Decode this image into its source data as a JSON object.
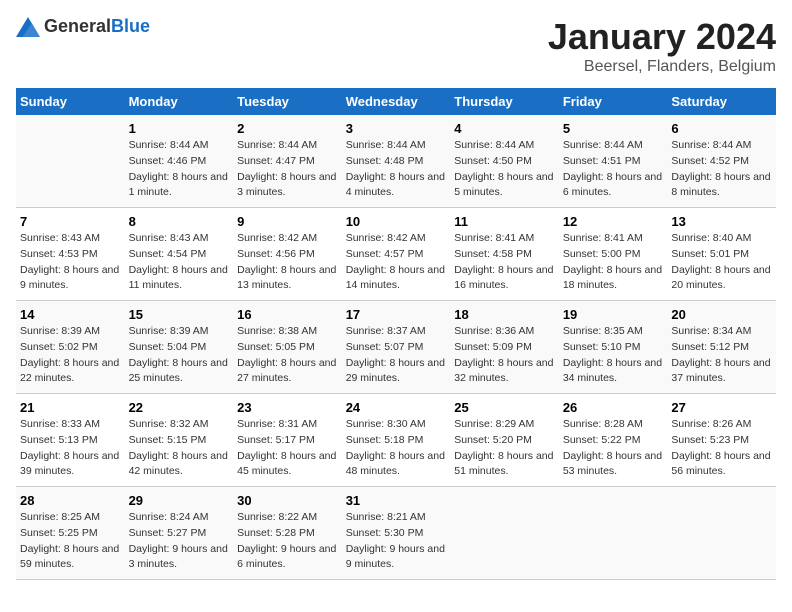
{
  "header": {
    "logo_general": "General",
    "logo_blue": "Blue",
    "title": "January 2024",
    "subtitle": "Beersel, Flanders, Belgium"
  },
  "weekdays": [
    "Sunday",
    "Monday",
    "Tuesday",
    "Wednesday",
    "Thursday",
    "Friday",
    "Saturday"
  ],
  "weeks": [
    [
      {
        "day": "",
        "sunrise": "",
        "sunset": "",
        "daylight": ""
      },
      {
        "day": "1",
        "sunrise": "Sunrise: 8:44 AM",
        "sunset": "Sunset: 4:46 PM",
        "daylight": "Daylight: 8 hours and 1 minute."
      },
      {
        "day": "2",
        "sunrise": "Sunrise: 8:44 AM",
        "sunset": "Sunset: 4:47 PM",
        "daylight": "Daylight: 8 hours and 3 minutes."
      },
      {
        "day": "3",
        "sunrise": "Sunrise: 8:44 AM",
        "sunset": "Sunset: 4:48 PM",
        "daylight": "Daylight: 8 hours and 4 minutes."
      },
      {
        "day": "4",
        "sunrise": "Sunrise: 8:44 AM",
        "sunset": "Sunset: 4:50 PM",
        "daylight": "Daylight: 8 hours and 5 minutes."
      },
      {
        "day": "5",
        "sunrise": "Sunrise: 8:44 AM",
        "sunset": "Sunset: 4:51 PM",
        "daylight": "Daylight: 8 hours and 6 minutes."
      },
      {
        "day": "6",
        "sunrise": "Sunrise: 8:44 AM",
        "sunset": "Sunset: 4:52 PM",
        "daylight": "Daylight: 8 hours and 8 minutes."
      }
    ],
    [
      {
        "day": "7",
        "sunrise": "Sunrise: 8:43 AM",
        "sunset": "Sunset: 4:53 PM",
        "daylight": "Daylight: 8 hours and 9 minutes."
      },
      {
        "day": "8",
        "sunrise": "Sunrise: 8:43 AM",
        "sunset": "Sunset: 4:54 PM",
        "daylight": "Daylight: 8 hours and 11 minutes."
      },
      {
        "day": "9",
        "sunrise": "Sunrise: 8:42 AM",
        "sunset": "Sunset: 4:56 PM",
        "daylight": "Daylight: 8 hours and 13 minutes."
      },
      {
        "day": "10",
        "sunrise": "Sunrise: 8:42 AM",
        "sunset": "Sunset: 4:57 PM",
        "daylight": "Daylight: 8 hours and 14 minutes."
      },
      {
        "day": "11",
        "sunrise": "Sunrise: 8:41 AM",
        "sunset": "Sunset: 4:58 PM",
        "daylight": "Daylight: 8 hours and 16 minutes."
      },
      {
        "day": "12",
        "sunrise": "Sunrise: 8:41 AM",
        "sunset": "Sunset: 5:00 PM",
        "daylight": "Daylight: 8 hours and 18 minutes."
      },
      {
        "day": "13",
        "sunrise": "Sunrise: 8:40 AM",
        "sunset": "Sunset: 5:01 PM",
        "daylight": "Daylight: 8 hours and 20 minutes."
      }
    ],
    [
      {
        "day": "14",
        "sunrise": "Sunrise: 8:39 AM",
        "sunset": "Sunset: 5:02 PM",
        "daylight": "Daylight: 8 hours and 22 minutes."
      },
      {
        "day": "15",
        "sunrise": "Sunrise: 8:39 AM",
        "sunset": "Sunset: 5:04 PM",
        "daylight": "Daylight: 8 hours and 25 minutes."
      },
      {
        "day": "16",
        "sunrise": "Sunrise: 8:38 AM",
        "sunset": "Sunset: 5:05 PM",
        "daylight": "Daylight: 8 hours and 27 minutes."
      },
      {
        "day": "17",
        "sunrise": "Sunrise: 8:37 AM",
        "sunset": "Sunset: 5:07 PM",
        "daylight": "Daylight: 8 hours and 29 minutes."
      },
      {
        "day": "18",
        "sunrise": "Sunrise: 8:36 AM",
        "sunset": "Sunset: 5:09 PM",
        "daylight": "Daylight: 8 hours and 32 minutes."
      },
      {
        "day": "19",
        "sunrise": "Sunrise: 8:35 AM",
        "sunset": "Sunset: 5:10 PM",
        "daylight": "Daylight: 8 hours and 34 minutes."
      },
      {
        "day": "20",
        "sunrise": "Sunrise: 8:34 AM",
        "sunset": "Sunset: 5:12 PM",
        "daylight": "Daylight: 8 hours and 37 minutes."
      }
    ],
    [
      {
        "day": "21",
        "sunrise": "Sunrise: 8:33 AM",
        "sunset": "Sunset: 5:13 PM",
        "daylight": "Daylight: 8 hours and 39 minutes."
      },
      {
        "day": "22",
        "sunrise": "Sunrise: 8:32 AM",
        "sunset": "Sunset: 5:15 PM",
        "daylight": "Daylight: 8 hours and 42 minutes."
      },
      {
        "day": "23",
        "sunrise": "Sunrise: 8:31 AM",
        "sunset": "Sunset: 5:17 PM",
        "daylight": "Daylight: 8 hours and 45 minutes."
      },
      {
        "day": "24",
        "sunrise": "Sunrise: 8:30 AM",
        "sunset": "Sunset: 5:18 PM",
        "daylight": "Daylight: 8 hours and 48 minutes."
      },
      {
        "day": "25",
        "sunrise": "Sunrise: 8:29 AM",
        "sunset": "Sunset: 5:20 PM",
        "daylight": "Daylight: 8 hours and 51 minutes."
      },
      {
        "day": "26",
        "sunrise": "Sunrise: 8:28 AM",
        "sunset": "Sunset: 5:22 PM",
        "daylight": "Daylight: 8 hours and 53 minutes."
      },
      {
        "day": "27",
        "sunrise": "Sunrise: 8:26 AM",
        "sunset": "Sunset: 5:23 PM",
        "daylight": "Daylight: 8 hours and 56 minutes."
      }
    ],
    [
      {
        "day": "28",
        "sunrise": "Sunrise: 8:25 AM",
        "sunset": "Sunset: 5:25 PM",
        "daylight": "Daylight: 8 hours and 59 minutes."
      },
      {
        "day": "29",
        "sunrise": "Sunrise: 8:24 AM",
        "sunset": "Sunset: 5:27 PM",
        "daylight": "Daylight: 9 hours and 3 minutes."
      },
      {
        "day": "30",
        "sunrise": "Sunrise: 8:22 AM",
        "sunset": "Sunset: 5:28 PM",
        "daylight": "Daylight: 9 hours and 6 minutes."
      },
      {
        "day": "31",
        "sunrise": "Sunrise: 8:21 AM",
        "sunset": "Sunset: 5:30 PM",
        "daylight": "Daylight: 9 hours and 9 minutes."
      },
      {
        "day": "",
        "sunrise": "",
        "sunset": "",
        "daylight": ""
      },
      {
        "day": "",
        "sunrise": "",
        "sunset": "",
        "daylight": ""
      },
      {
        "day": "",
        "sunrise": "",
        "sunset": "",
        "daylight": ""
      }
    ]
  ]
}
